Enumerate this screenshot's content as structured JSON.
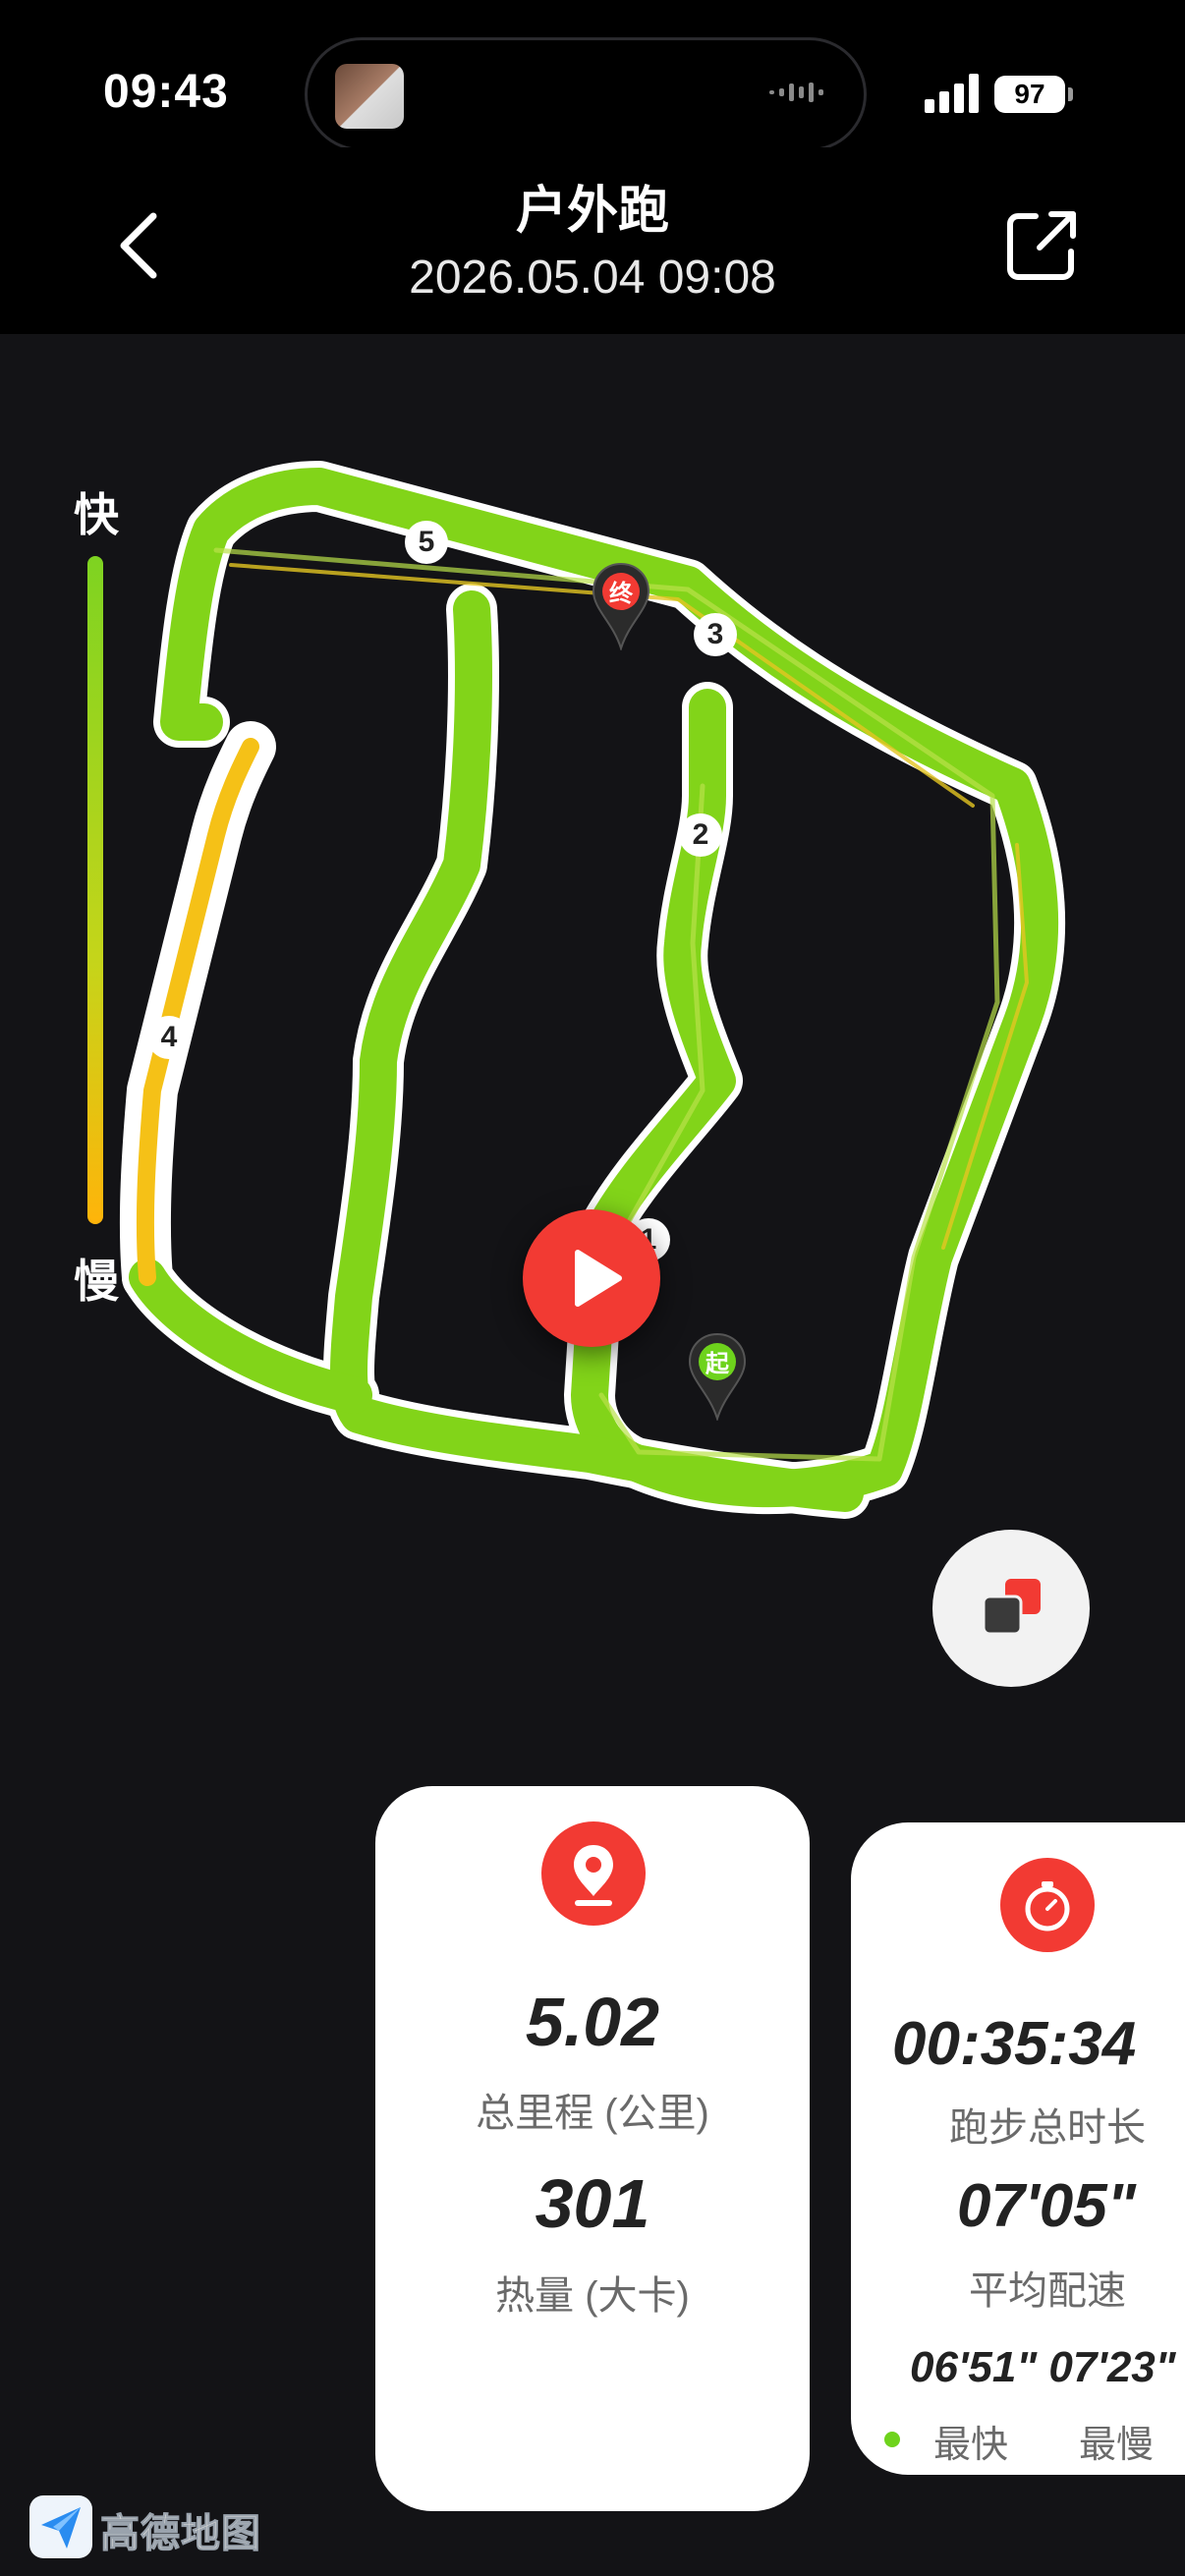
{
  "status_bar": {
    "time": "09:43",
    "battery": "97"
  },
  "header": {
    "title": "户外跑",
    "subtitle": "2026.05.04 09:08"
  },
  "pace_legend": {
    "fast": "快",
    "slow": "慢",
    "fast_color": "#7ed321",
    "slow_color": "#ffb40a"
  },
  "map": {
    "km_markers": [
      "1",
      "2",
      "3",
      "4",
      "5"
    ],
    "start_label": "起",
    "end_label": "终",
    "route_color": "#82d419",
    "accent": "#f23a33"
  },
  "stats_card_1": {
    "distance_value": "5.02",
    "distance_label": "总里程 (公里)",
    "calories_value": "301",
    "calories_label": "热量 (大卡)"
  },
  "stats_card_2": {
    "duration_value": "00:35:34",
    "duration_label": "跑步总时长",
    "pace_value": "07'05\"",
    "pace_label": "平均配速",
    "fastest_slowest_value": "06'51\" 07'23\"",
    "fastest_label": "最快",
    "slowest_label": "最慢"
  },
  "map_provider": {
    "name": "高德地图"
  }
}
